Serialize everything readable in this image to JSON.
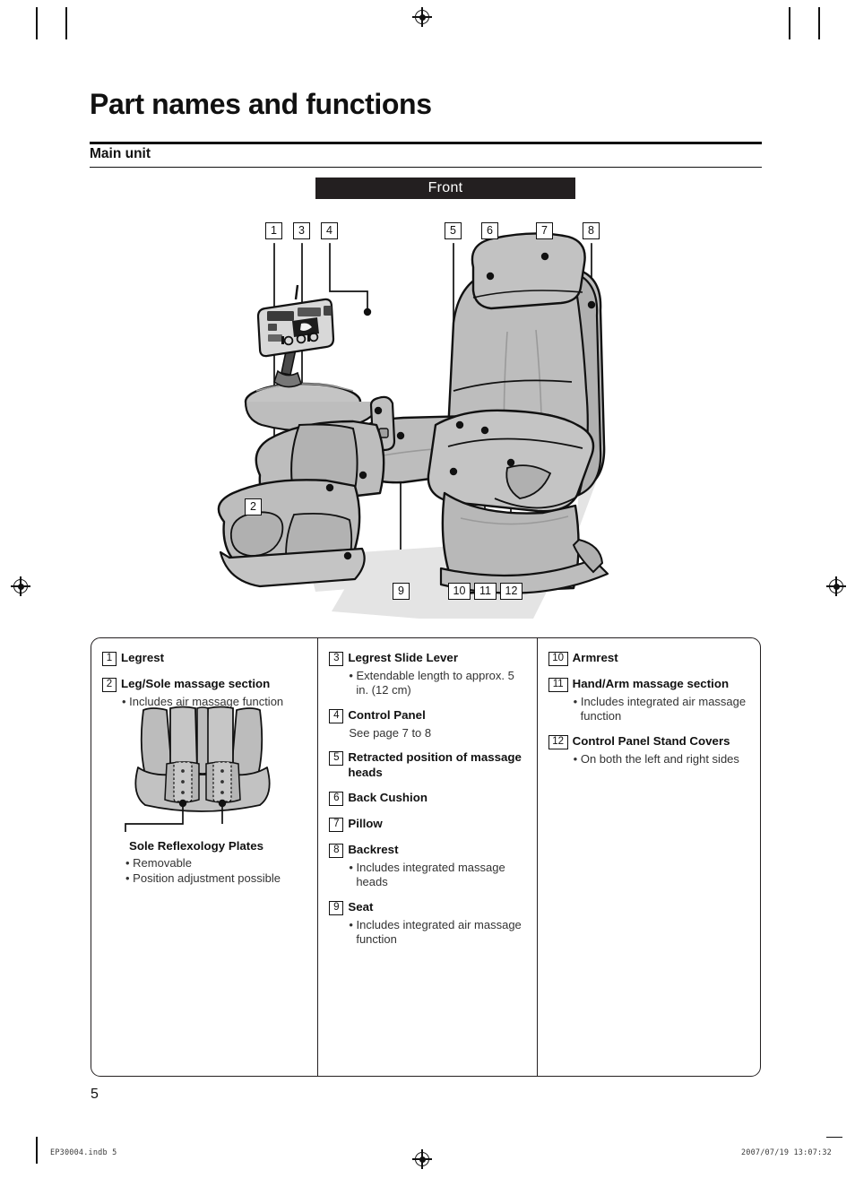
{
  "document": {
    "title": "Part names and functions",
    "section": "Main unit",
    "orientation_banner": "Front",
    "page_number": "5"
  },
  "illustration": {
    "alt": "massage-chair-front-view",
    "top_callouts": [
      "1",
      "3",
      "4",
      "5",
      "6",
      "7",
      "8"
    ],
    "left_callouts": [
      "2"
    ],
    "bottom_callouts": [
      "9",
      "10",
      "11",
      "12"
    ]
  },
  "legend": {
    "columns": [
      {
        "items": [
          {
            "num": "1",
            "name": "Legrest",
            "bullets": []
          },
          {
            "num": "2",
            "name": "Leg/Sole massage section",
            "bullets": [
              "Includes air massage function"
            ]
          }
        ],
        "detail": {
          "caption": "Sole Reflexology Plates",
          "bullets": [
            "Removable",
            "Position adjustment possible"
          ]
        }
      },
      {
        "items": [
          {
            "num": "3",
            "name": "Legrest Slide Lever",
            "bullets": [
              "Extendable length to approx. 5 in. (12 cm)"
            ]
          },
          {
            "num": "4",
            "name": "Control Panel",
            "note": "See page 7 to 8",
            "bullets": []
          },
          {
            "num": "5",
            "name": "Retracted position of massage heads",
            "bullets": []
          },
          {
            "num": "6",
            "name": "Back Cushion",
            "bullets": []
          },
          {
            "num": "7",
            "name": "Pillow",
            "bullets": []
          },
          {
            "num": "8",
            "name": "Backrest",
            "bullets": [
              "Includes integrated massage heads"
            ]
          },
          {
            "num": "9",
            "name": "Seat",
            "bullets": [
              "Includes integrated air massage function"
            ]
          }
        ]
      },
      {
        "items": [
          {
            "num": "10",
            "name": "Armrest",
            "bullets": []
          },
          {
            "num": "11",
            "name": "Hand/Arm massage section",
            "bullets": [
              "Includes integrated air massage function"
            ]
          },
          {
            "num": "12",
            "name": "Control Panel Stand Covers",
            "bullets": [
              "On both the left and right sides"
            ]
          }
        ]
      }
    ]
  },
  "footer": {
    "file_ref": "EP30004.indb   5",
    "timestamp": "2007/07/19   13:07:32"
  },
  "colors": {
    "ink": "#231f20",
    "banner_bg": "#231f20",
    "banner_text": "#ffffff",
    "chair_fill": "#b5b5b5",
    "chair_fill_light": "#c9c9c9",
    "chair_shadow": "#e2e2e2"
  }
}
